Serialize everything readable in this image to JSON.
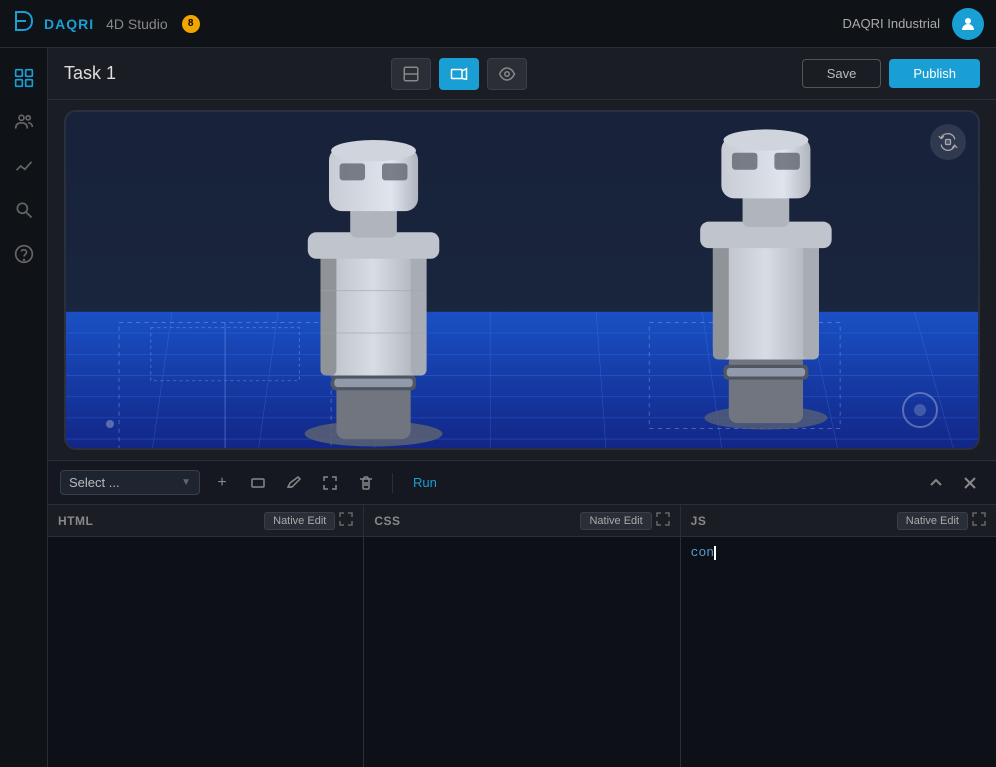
{
  "app": {
    "logo_text": "DAQRI",
    "studio_text": "4D Studio",
    "warning_count": "8",
    "company_name": "DAQRI Industrial"
  },
  "taskbar": {
    "title": "Task 1",
    "save_label": "Save",
    "publish_label": "Publish"
  },
  "sidebar": {
    "items": [
      {
        "name": "layers-icon",
        "symbol": "⧉"
      },
      {
        "name": "users-icon",
        "symbol": "👥"
      },
      {
        "name": "chart-icon",
        "symbol": "〜"
      },
      {
        "name": "search-icon",
        "symbol": "🔍"
      },
      {
        "name": "help-icon",
        "symbol": "?"
      }
    ]
  },
  "toolbar": {
    "select_label": "Select ...",
    "run_label": "Run",
    "add_icon": "+",
    "rect_icon": "▭",
    "pencil_icon": "✏",
    "transform_icon": "⤢",
    "delete_icon": "✕"
  },
  "editors": [
    {
      "lang": "HTML",
      "native_edit_label": "Native Edit",
      "code": ""
    },
    {
      "lang": "CSS",
      "native_edit_label": "Native Edit",
      "code": ""
    },
    {
      "lang": "JS",
      "native_edit_label": "Native Edit",
      "code": "con"
    }
  ]
}
